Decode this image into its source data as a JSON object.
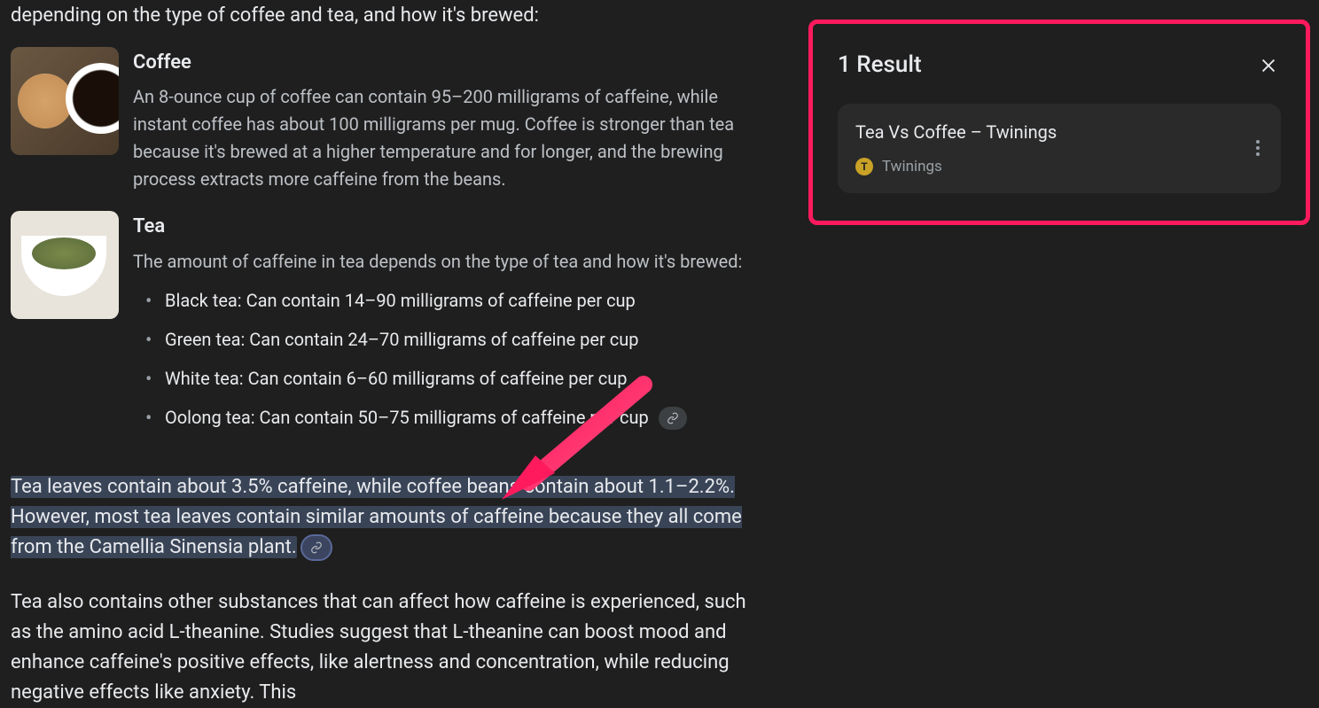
{
  "intro": "depending on the type of coffee and tea, and how it's brewed:",
  "coffee": {
    "title": "Coffee",
    "desc": "An 8-ounce cup of coffee can contain 95–200 milligrams of caffeine, while instant coffee has about 100 milligrams per mug. Coffee is stronger than tea because it's brewed at a higher temperature and for longer, and the brewing process extracts more caffeine from the beans."
  },
  "tea": {
    "title": "Tea",
    "desc": "The amount of caffeine in tea depends on the type of tea and how it's brewed:",
    "items": [
      "Black tea: Can contain 14–90 milligrams of caffeine per cup",
      "Green tea: Can contain 24–70 milligrams of caffeine per cup",
      "White tea: Can contain 6–60 milligrams of caffeine per cup",
      "Oolong tea: Can contain 50–75 milligrams of caffeine per cup"
    ]
  },
  "highlighted_para": "Tea leaves contain about 3.5% caffeine, while coffee beans contain about 1.1–2.2%. However, most tea leaves contain similar amounts of caffeine because they all come from the Camellia Sinensia plant.",
  "para2": "Tea also contains other substances that can affect how caffeine is experienced, such as the amino acid L-theanine. Studies suggest that L-theanine can boost mood and enhance caffeine's positive effects, like alertness and concentration, while reducing negative effects like anxiety. This",
  "results": {
    "header": "1 Result",
    "card": {
      "title": "Tea Vs Coffee – Twinings",
      "source": "Twinings",
      "favicon_letter": "T"
    }
  }
}
